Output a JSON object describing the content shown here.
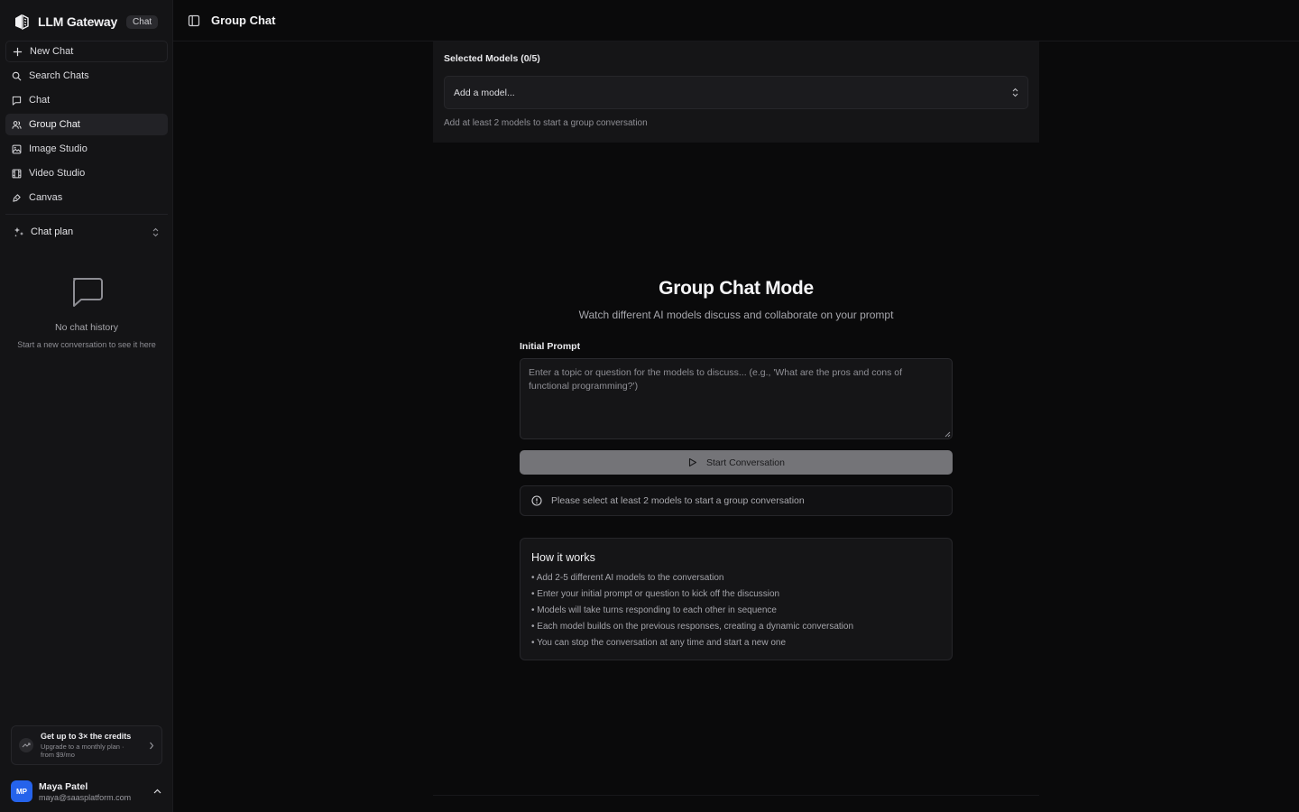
{
  "colors": {
    "background": "#0a0a0b",
    "sidebar": "#141416",
    "avatar": "#2563eb",
    "button_disabled": "#747478"
  },
  "brand": {
    "name": "LLM Gateway",
    "badge": "Chat",
    "icon": "gateway-logo-icon"
  },
  "sidebar": {
    "items": [
      {
        "label": "New Chat",
        "icon": "plus-icon"
      },
      {
        "label": "Search Chats",
        "icon": "search-icon"
      },
      {
        "label": "Chat",
        "icon": "message-square-icon"
      },
      {
        "label": "Group Chat",
        "icon": "users-icon",
        "active": true
      },
      {
        "label": "Image Studio",
        "icon": "image-icon"
      },
      {
        "label": "Video Studio",
        "icon": "film-icon"
      },
      {
        "label": "Canvas",
        "icon": "pen-tool-icon"
      }
    ],
    "plan": {
      "label": "Chat plan",
      "icon": "sparkles-icon"
    },
    "empty": {
      "title": "No chat history",
      "subtitle": "Start a new conversation to see it here",
      "icon": "message-square-icon"
    },
    "upgrade": {
      "title": "Get up to 3× the credits",
      "subtitle": "Upgrade to a monthly plan · from $9/mo",
      "icon": "trending-up-icon"
    },
    "user": {
      "initials": "MP",
      "name": "Maya Patel",
      "email": "maya@saasplatform.com"
    }
  },
  "header": {
    "title": "Group Chat",
    "toggle_icon": "sidebar-toggle-icon"
  },
  "models": {
    "label": "Selected Models (0/5)",
    "select_placeholder": "Add a model...",
    "hint": "Add at least 2 models to start a group conversation"
  },
  "main": {
    "title": "Group Chat Mode",
    "subtitle": "Watch different AI models discuss and collaborate on your prompt",
    "prompt_label": "Initial Prompt",
    "prompt_placeholder": "Enter a topic or question for the models to discuss... (e.g., 'What are the pros and cons of functional programming?')",
    "start_button": "Start Conversation",
    "alert": "Please select at least 2 models to start a group conversation",
    "how_title": "How it works",
    "how_items": [
      "• Add 2-5 different AI models to the conversation",
      "• Enter your initial prompt or question to kick off the discussion",
      "• Models will take turns responding to each other in sequence",
      "• Each model builds on the previous responses, creating a dynamic conversation",
      "• You can stop the conversation at any time and start a new one"
    ]
  }
}
